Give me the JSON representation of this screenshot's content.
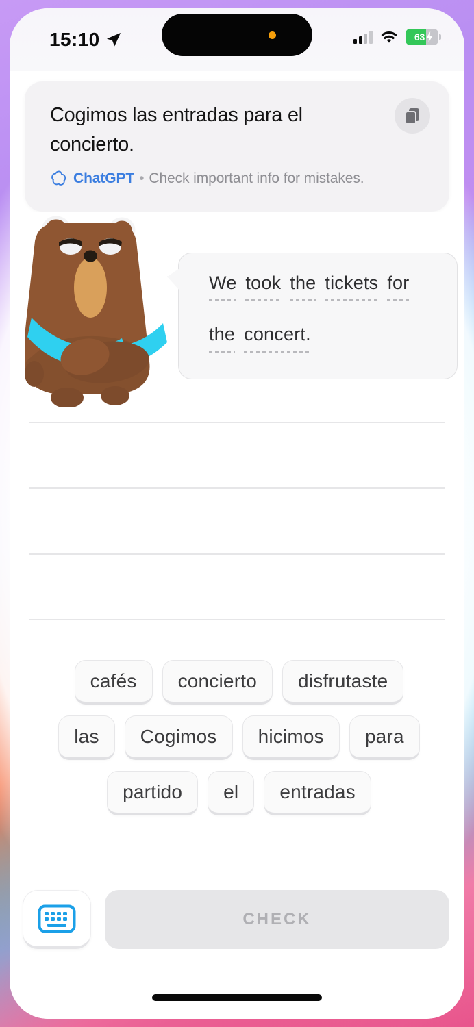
{
  "status_bar": {
    "time": "15:10",
    "location_icon": "location-arrow-icon",
    "cellular_icon": "cellular-signal-icon",
    "wifi_icon": "wifi-icon",
    "battery_percent": "63",
    "battery_icon": "battery-charging-icon",
    "island_indicator": "orange-activity-dot"
  },
  "notification": {
    "title": "Cogimos las entradas para el concierto.",
    "app_name": "ChatGPT",
    "separator": "•",
    "disclaimer": "Check important info for mistakes.",
    "logo_icon": "chatgpt-logo-icon",
    "copy_icon": "copy-icon",
    "accent_color": "#3b7ee0"
  },
  "exercise": {
    "mascot": "bear-character",
    "prompt_lines": [
      [
        "We",
        "took",
        "the",
        "tickets",
        "for"
      ],
      [
        "the",
        "concert."
      ]
    ],
    "answer_slots": [
      "",
      "",
      ""
    ],
    "word_bank": [
      "cafés",
      "concierto",
      "disfrutaste",
      "las",
      "Cogimos",
      "hicimos",
      "para",
      "partido",
      "el",
      "entradas"
    ]
  },
  "bottom_bar": {
    "keyboard_icon": "keyboard-icon",
    "keyboard_accent": "#1ba0e8",
    "check_label": "CHECK"
  },
  "colors": {
    "glow_top": "#c79af5",
    "glow_right": "#2ec5f5",
    "glow_bottom": "#e8558c",
    "glow_left": "#f4774d",
    "bear_body": "#8f5632",
    "bear_muzzle": "#d9a05b",
    "bear_scarf": "#2fd0f0"
  }
}
